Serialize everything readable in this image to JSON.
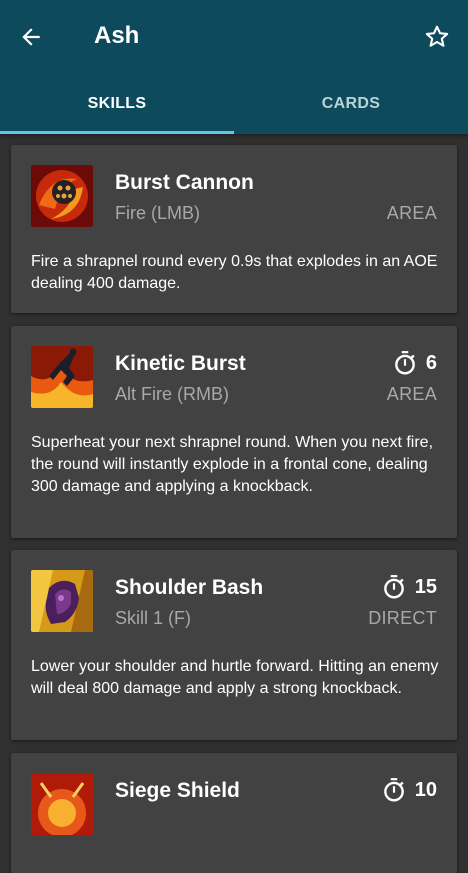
{
  "header": {
    "title": "Ash"
  },
  "tabs": [
    {
      "label": "SKILLS",
      "active": true
    },
    {
      "label": "CARDS",
      "active": false
    }
  ],
  "skills": [
    {
      "name": "Burst Cannon",
      "key": "Fire (LMB)",
      "type": "AREA",
      "cooldown": null,
      "description": "Fire a shrapnel round every 0.9s that explodes in an AOE dealing 400 damage.",
      "icon": "burst-cannon-icon"
    },
    {
      "name": "Kinetic Burst",
      "key": "Alt Fire (RMB)",
      "type": "AREA",
      "cooldown": "6",
      "description": "Superheat your next shrapnel round. When you next fire, the round will instantly explode in a frontal cone, dealing 300 damage and applying a knockback.",
      "icon": "kinetic-burst-icon"
    },
    {
      "name": "Shoulder Bash",
      "key": "Skill 1 (F)",
      "type": "DIRECT",
      "cooldown": "15",
      "description": "Lower your shoulder and hurtle forward. Hitting an enemy will deal 800 damage and apply a strong knockback.",
      "icon": "shoulder-bash-icon"
    },
    {
      "name": "Siege Shield",
      "key": "",
      "type": "",
      "cooldown": "10",
      "description": "",
      "icon": "siege-shield-icon"
    }
  ],
  "colors": {
    "appbar": "#0d4b5c",
    "indicator": "#5fc8e8",
    "card": "#424242",
    "background": "#303030"
  }
}
